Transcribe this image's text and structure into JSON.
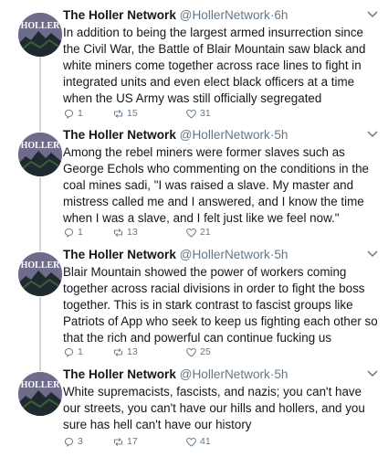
{
  "tweets": [
    {
      "author": "The Holler Network",
      "handle": "@HollerNetwork",
      "separator": "·",
      "time": "6h",
      "text": "In addition to being the largest armed insurrection since the Civil War, the Battle of Blair Mountain saw black and white miners come together across race lines to fight in integrated units and even elect black officers at a time when the US Army was still officially segregated",
      "replies": "1",
      "retweets": "15",
      "likes": "31",
      "avatar_text": "HOLLER"
    },
    {
      "author": "The Holler Network",
      "handle": "@HollerNetwork",
      "separator": "·",
      "time": "5h",
      "text": "Among the rebel miners were former slaves such as George Echols who commenting on the conditions in the coal mines sadi, \"I was raised a slave. My master and mistress called me and I answered, and I know the time when I was a slave, and I felt just like we feel now.\"",
      "replies": "1",
      "retweets": "13",
      "likes": "21",
      "avatar_text": "HOLLER"
    },
    {
      "author": "The Holler Network",
      "handle": "@HollerNetwork",
      "separator": "·",
      "time": "5h",
      "text": "Blair Mountain showed the power of workers coming together across racial divisions in order to fight the boss together. This is in stark contrast to fascist groups like Patriots of App who seek to keep us fighting each other so that the rich and powerful can continue fucking us",
      "replies": "1",
      "retweets": "13",
      "likes": "25",
      "avatar_text": "HOLLER"
    },
    {
      "author": "The Holler Network",
      "handle": "@HollerNetwork",
      "separator": "·",
      "time": "5h",
      "text": "White supremacists, fascists, and nazis; you can't have our streets, you can't have our hills and hollers, and you sure has hell can't have our history",
      "replies": "3",
      "retweets": "17",
      "likes": "41",
      "avatar_text": "HOLLER"
    }
  ],
  "icons": {
    "reply": "reply-icon",
    "retweet": "retweet-icon",
    "like": "heart-icon",
    "more": "chevron-down-icon"
  },
  "colors": {
    "text": "#14171a",
    "secondary": "#657786",
    "thread_line": "#ccd6dd",
    "avatar_bg": "#6f6b8a"
  }
}
